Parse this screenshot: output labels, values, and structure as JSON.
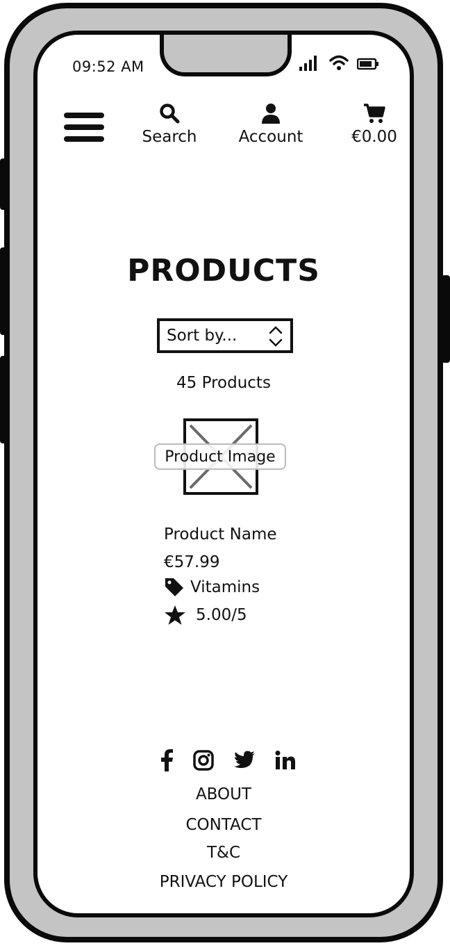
{
  "status_bar": {
    "time": "09:52 AM"
  },
  "nav": {
    "search_label": "Search",
    "account_label": "Account",
    "cart_total": "€0.00"
  },
  "page": {
    "title": "PRODUCTS",
    "sort_placeholder": "Sort by...",
    "product_count": "45 Products"
  },
  "product": {
    "image_label": "Product Image",
    "name": "Product Name",
    "price": "€57.99",
    "category": "Vitamins",
    "rating": "5.00/5"
  },
  "footer": {
    "social_icons": [
      "facebook-icon",
      "instagram-icon",
      "twitter-icon",
      "linkedin-icon"
    ],
    "links": [
      "ABOUT",
      "CONTACT",
      "T&C",
      "PRIVACY POLICY"
    ]
  },
  "colors": {
    "frame": "#c4c4c4",
    "outline": "#0a0a0a",
    "screen": "#ffffff",
    "placeholder_cross": "#6a6a6a"
  }
}
